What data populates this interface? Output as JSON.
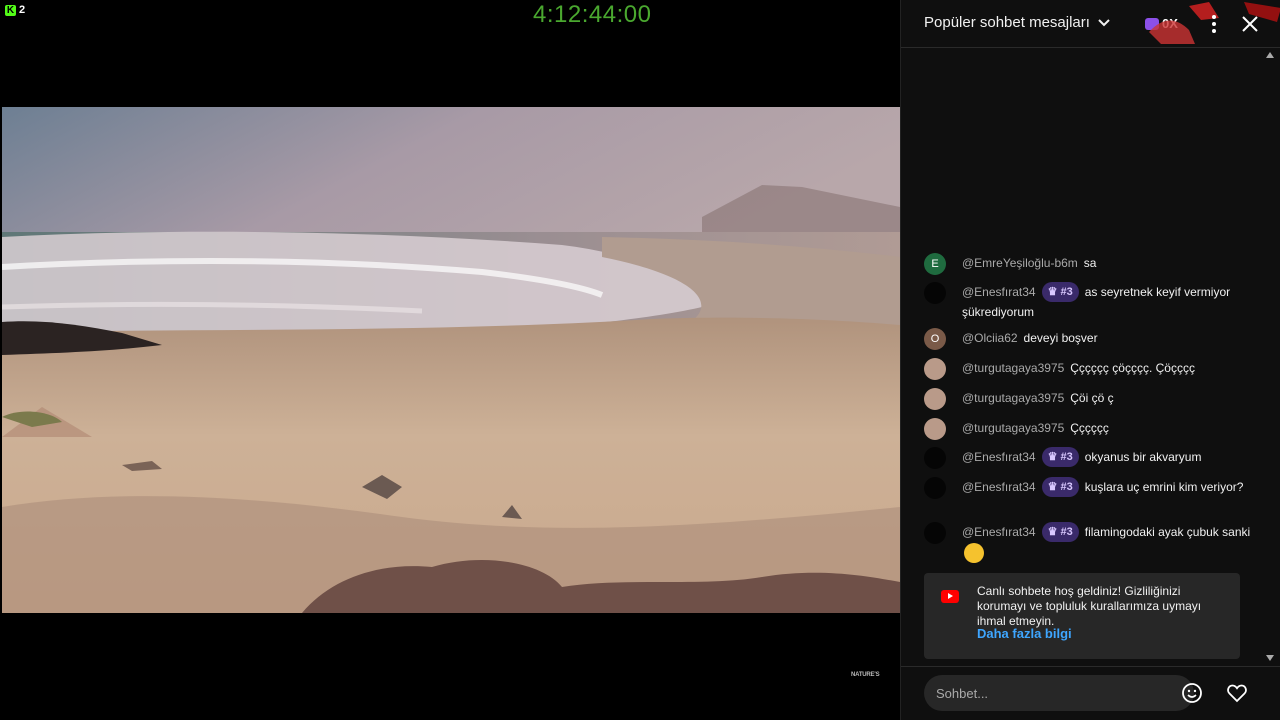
{
  "stream": {
    "kick_count": "2",
    "timer": "4:12:44:00",
    "watermark": "NATURE'S"
  },
  "chat": {
    "title": "Popüler sohbet mesajları",
    "viewer_count": "0X",
    "messages": [
      {
        "avatar_letter": "E",
        "author": "@EmreYeşiloğlu-b6m",
        "badge": "",
        "text": "sa"
      },
      {
        "avatar_letter": "",
        "author": "@Enesfırat34",
        "badge": "#3",
        "text": "as seyretnek keyif vermiyor şükrediyorum"
      },
      {
        "avatar_letter": "O",
        "author": "@Olciia62",
        "badge": "",
        "text": "deveyi boşver"
      },
      {
        "avatar_letter": "",
        "author": "@turgutagaya3975",
        "badge": "",
        "text": "Çççççç çöçççç. Çöçççç"
      },
      {
        "avatar_letter": "",
        "author": "@turgutagaya3975",
        "badge": "",
        "text": "Çöi çö ç"
      },
      {
        "avatar_letter": "",
        "author": "@turgutagaya3975",
        "badge": "",
        "text": "Çççççç"
      },
      {
        "avatar_letter": "",
        "author": "@Enesfırat34",
        "badge": "#3",
        "text": "okyanus bir akvaryum"
      },
      {
        "avatar_letter": "",
        "author": "@Enesfırat34",
        "badge": "#3",
        "text": "kuşlara uç emrini kim veriyor?"
      },
      {
        "avatar_letter": "",
        "author": "@Enesfırat34",
        "badge": "#3",
        "text": "filamingodaki ayak çubuk sanki"
      }
    ],
    "welcome": {
      "text": "Canlı sohbete hoş geldiniz! Gizliliğinizi korumayı ve topluluk kurallarımıza uymayı ihmal etmeyin.",
      "link": "Daha fazla bilgi"
    },
    "input_placeholder": "Sohbet..."
  },
  "colors": {
    "timer": "#4aa82f",
    "kick_green": "#53fc18",
    "badge_purple": "#3a2a6a",
    "link_blue": "#3ea6ff",
    "youtube_red": "#ff0000"
  }
}
